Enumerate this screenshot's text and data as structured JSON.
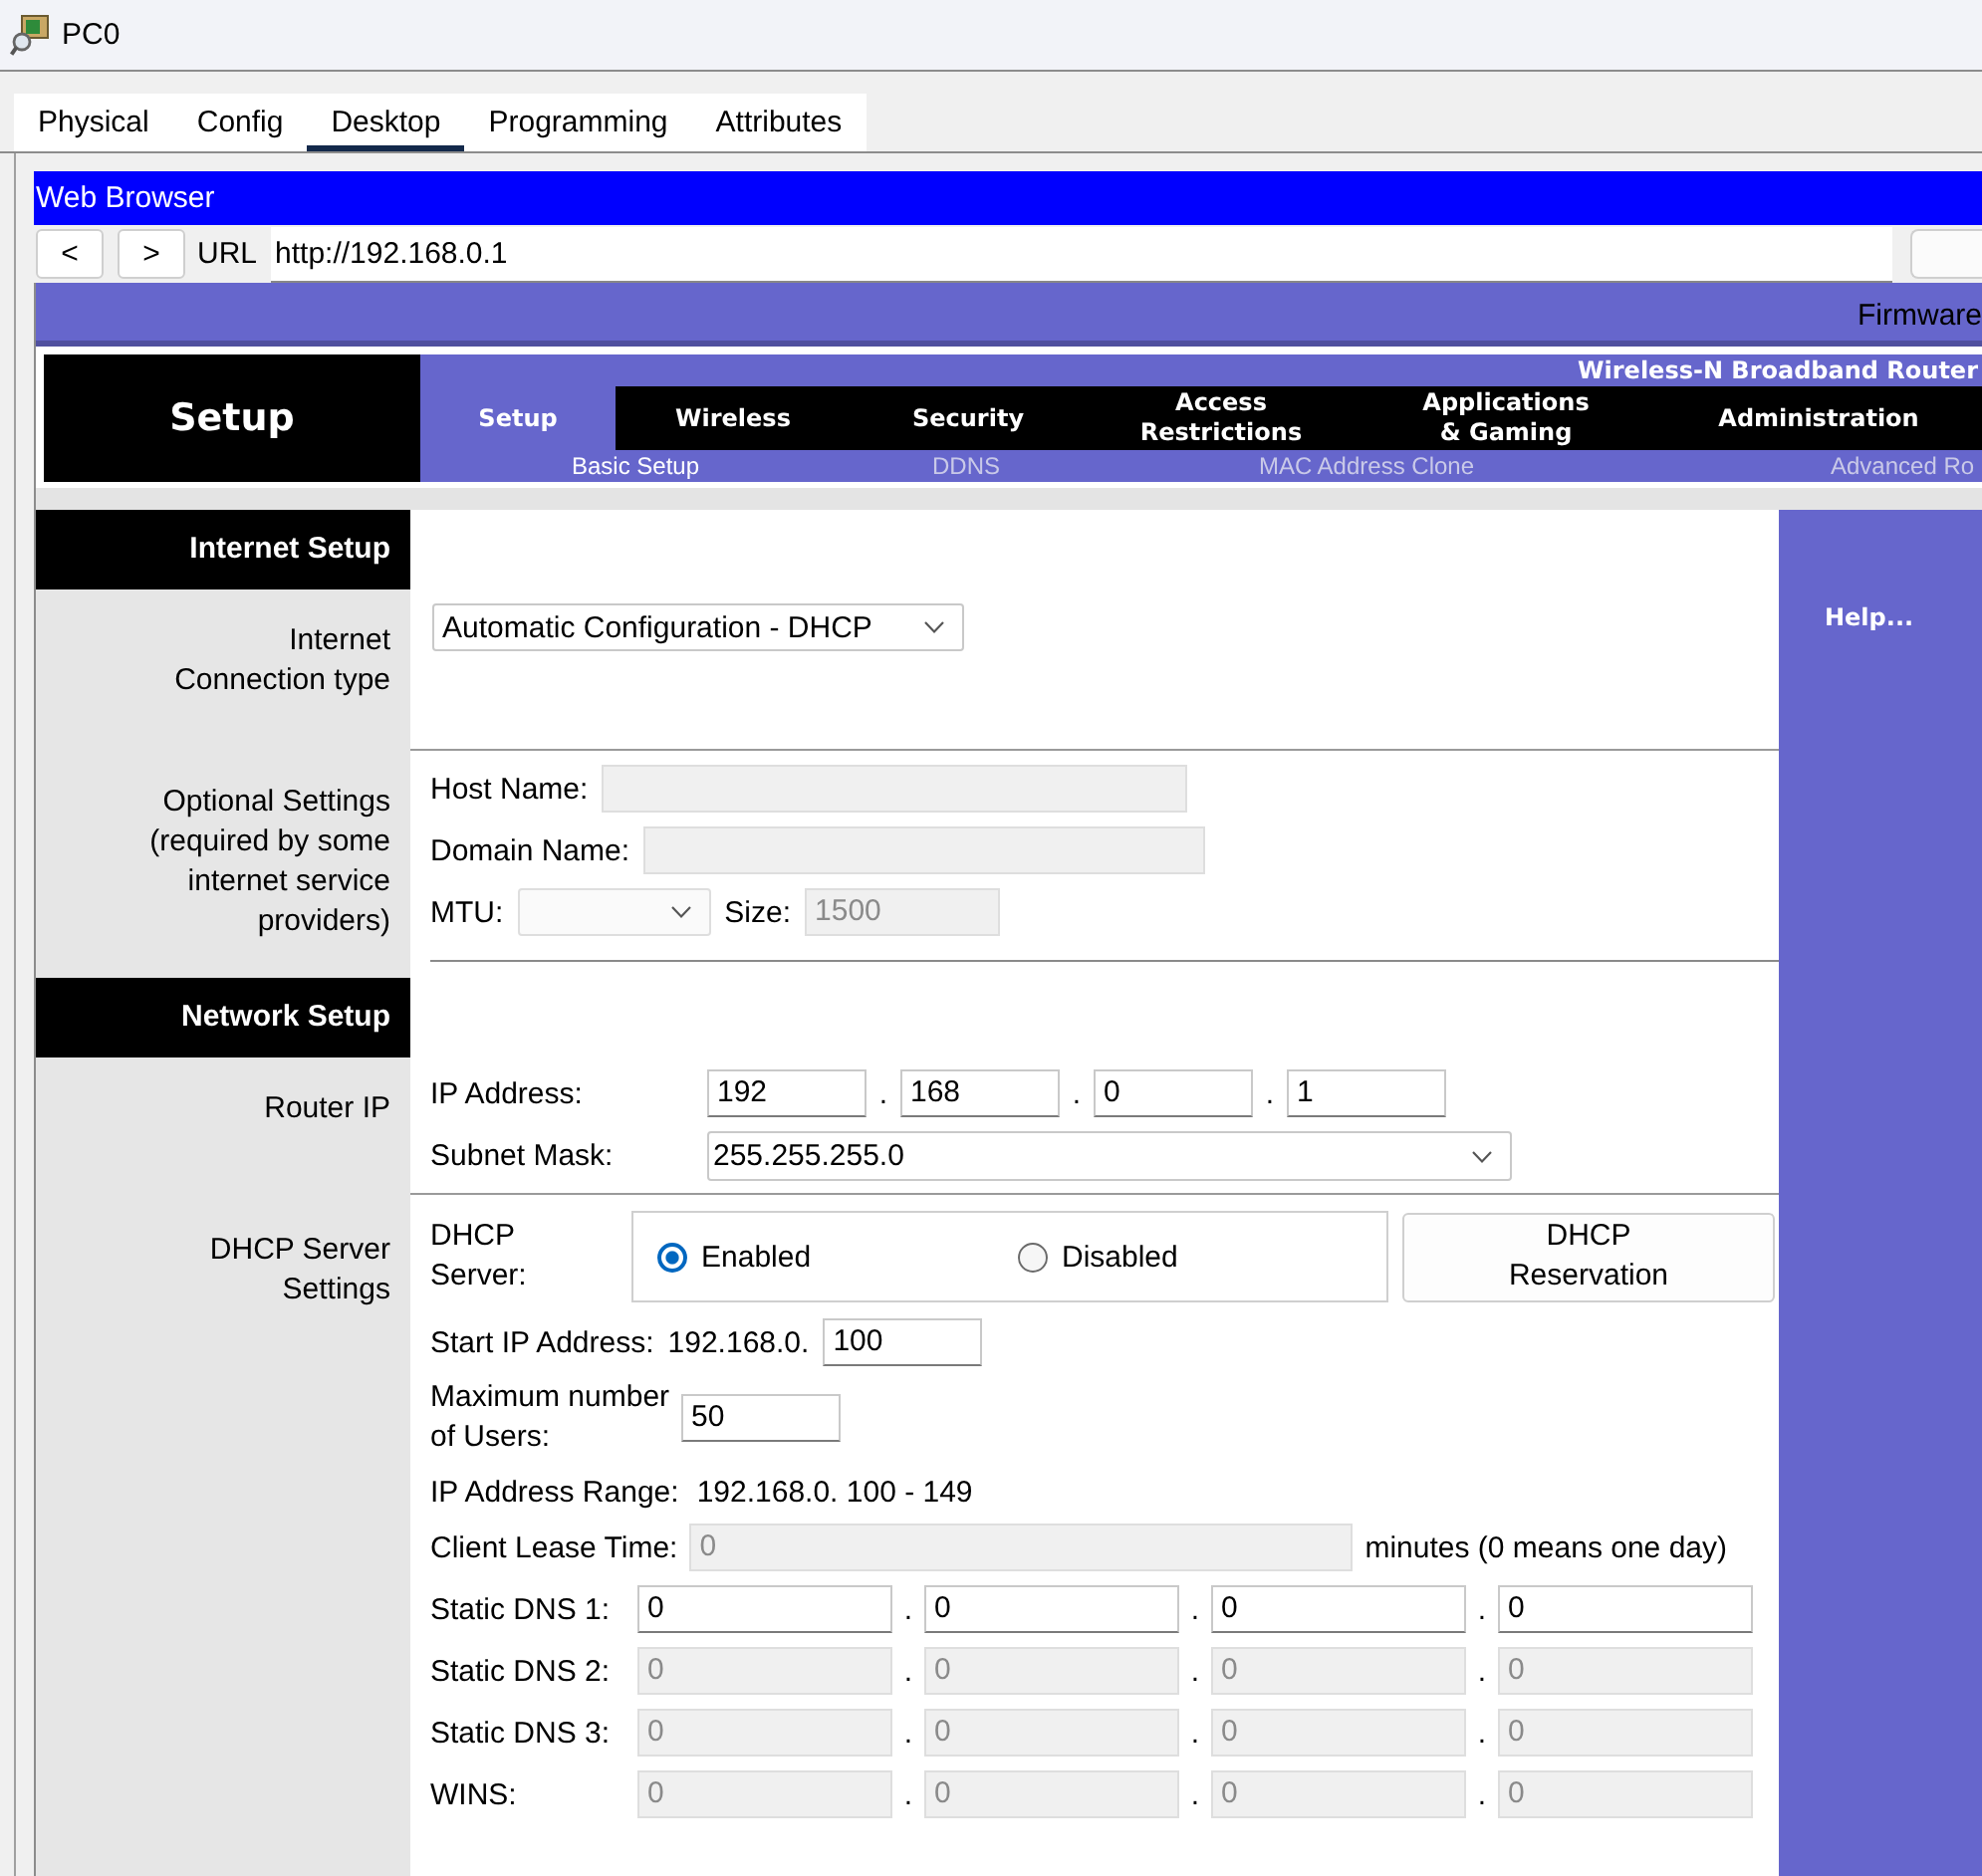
{
  "window": {
    "title": "PC0"
  },
  "tabs": [
    {
      "label": "Physical",
      "selected": false
    },
    {
      "label": "Config",
      "selected": false
    },
    {
      "label": "Desktop",
      "selected": true
    },
    {
      "label": "Programming",
      "selected": false
    },
    {
      "label": "Attributes",
      "selected": false
    }
  ],
  "browser": {
    "title": "Web Browser",
    "back": "<",
    "forward": ">",
    "url_label": "URL",
    "url": "http://192.168.0.1"
  },
  "router": {
    "firmware": "Firmware",
    "page_title": "Setup",
    "product": "Wireless-N Broadband Router",
    "nav": [
      {
        "label": "Setup",
        "selected": true
      },
      {
        "label": "Wireless",
        "selected": false
      },
      {
        "label": "Security",
        "selected": false
      },
      {
        "label": "Access\nRestrictions",
        "selected": false
      },
      {
        "label": "Applications\n& Gaming",
        "selected": false
      },
      {
        "label": "Administration",
        "selected": false
      }
    ],
    "subnav": [
      {
        "label": "Basic Setup",
        "selected": true
      },
      {
        "label": "DDNS",
        "selected": false
      },
      {
        "label": "MAC Address Clone",
        "selected": false
      },
      {
        "label": "Advanced Ro",
        "selected": false
      }
    ],
    "help": "Help...",
    "internet_setup": {
      "heading": "Internet Setup",
      "connection_type": {
        "label": "Internet\nConnection type",
        "value": "Automatic Configuration - DHCP"
      },
      "optional_settings": {
        "label": "Optional Settings\n(required by some\ninternet service\nproviders)",
        "host_name": {
          "label": "Host Name:",
          "disabled": true
        },
        "domain_name": {
          "label": "Domain Name:",
          "disabled": true
        },
        "mtu": {
          "label": "MTU:",
          "disabled": true
        },
        "size": {
          "label": "Size:",
          "value": "1500",
          "disabled": true
        }
      }
    },
    "network_setup": {
      "heading": "Network Setup",
      "router_ip": {
        "label": "Router IP",
        "ip_address": {
          "label": "IP Address:",
          "octets": [
            "192",
            "168",
            "0",
            "1"
          ],
          "separators": [
            ".",
            ".",
            "."
          ]
        },
        "subnet_mask": {
          "label": "Subnet Mask:",
          "value": "255.255.255.0"
        }
      },
      "dhcp": {
        "label": "DHCP Server\nSettings",
        "server": {
          "label": "DHCP\nServer:",
          "options": [
            {
              "label": "Enabled",
              "selected": true
            },
            {
              "label": "Disabled",
              "selected": false
            }
          ]
        },
        "reservation_button": "DHCP\nReservation",
        "start_ip": {
          "label": "Start IP Address:",
          "prefix": "192.168.0.",
          "value": "100"
        },
        "max_users": {
          "label": "Maximum number\nof Users:",
          "value": "50"
        },
        "range": {
          "label": "IP Address Range:",
          "value": "192.168.0. 100 - 149"
        },
        "lease_time": {
          "label": "Client Lease Time:",
          "value": "0",
          "disabled": true,
          "suffix": "minutes (0 means one day)"
        },
        "dns": [
          {
            "label": "Static DNS 1:",
            "disabled": false,
            "octets": [
              "0",
              "0",
              "0",
              "0"
            ],
            "separators": [
              ".",
              ".",
              "."
            ]
          },
          {
            "label": "Static DNS 2:",
            "disabled": true,
            "octets": [
              "0",
              "0",
              "0",
              "0"
            ],
            "separators": [
              ".",
              ".",
              "."
            ]
          },
          {
            "label": "Static DNS 3:",
            "disabled": true,
            "octets": [
              "0",
              "0",
              "0",
              "0"
            ],
            "separators": [
              ".",
              ".",
              "."
            ]
          },
          {
            "label": "WINS:",
            "disabled": true,
            "octets": [
              "0",
              "0",
              "0",
              "0"
            ],
            "separators": [
              ".",
              ".",
              "."
            ]
          }
        ]
      }
    }
  }
}
